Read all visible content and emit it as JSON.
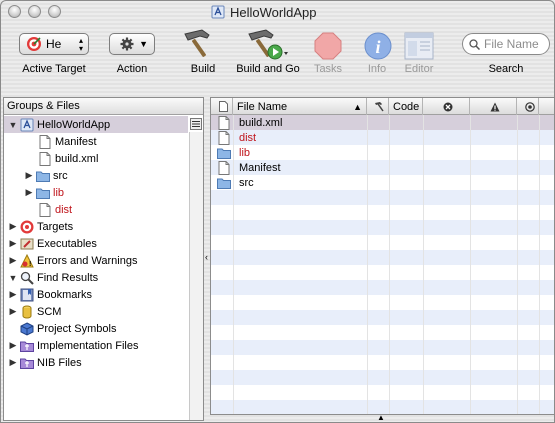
{
  "window": {
    "title": "HelloWorldApp"
  },
  "toolbar": {
    "active_target": {
      "value": "He",
      "label": "Active Target"
    },
    "action": {
      "label": "Action"
    },
    "build": {
      "label": "Build"
    },
    "build_and_go": {
      "label": "Build and Go"
    },
    "tasks": {
      "label": "Tasks"
    },
    "info": {
      "label": "Info"
    },
    "editor": {
      "label": "Editor"
    },
    "search": {
      "placeholder": "File Name",
      "label": "Search"
    }
  },
  "groups": {
    "header": "Groups & Files",
    "items": [
      {
        "label": "HelloWorldApp",
        "icon": "xcode-project-icon",
        "expanded": true
      },
      {
        "label": "Manifest",
        "icon": "document-icon"
      },
      {
        "label": "build.xml",
        "icon": "document-icon"
      },
      {
        "label": "src",
        "icon": "folder-icon"
      },
      {
        "label": "lib",
        "icon": "folder-icon",
        "color": "#c0151c"
      },
      {
        "label": "dist",
        "icon": "document-icon",
        "color": "#c0151c"
      },
      {
        "label": "Targets",
        "icon": "target-icon"
      },
      {
        "label": "Executables",
        "icon": "executables-icon"
      },
      {
        "label": "Errors and Warnings",
        "icon": "warning-icon"
      },
      {
        "label": "Find Results",
        "icon": "magnifier-icon"
      },
      {
        "label": "Bookmarks",
        "icon": "bookmarks-icon"
      },
      {
        "label": "SCM",
        "icon": "scm-icon"
      },
      {
        "label": "Project Symbols",
        "icon": "symbols-icon"
      },
      {
        "label": "Implementation Files",
        "icon": "smart-group-icon"
      },
      {
        "label": "NIB Files",
        "icon": "smart-group-icon"
      }
    ]
  },
  "files": {
    "columns": {
      "file_name": "File Name",
      "code": "Code"
    },
    "rows": [
      {
        "name": "build.xml",
        "icon": "document-icon"
      },
      {
        "name": "dist",
        "icon": "document-icon",
        "color": "#c0151c"
      },
      {
        "name": "lib",
        "icon": "folder-icon",
        "color": "#c0151c"
      },
      {
        "name": "Manifest",
        "icon": "document-icon"
      },
      {
        "name": "src",
        "icon": "folder-icon"
      }
    ]
  }
}
